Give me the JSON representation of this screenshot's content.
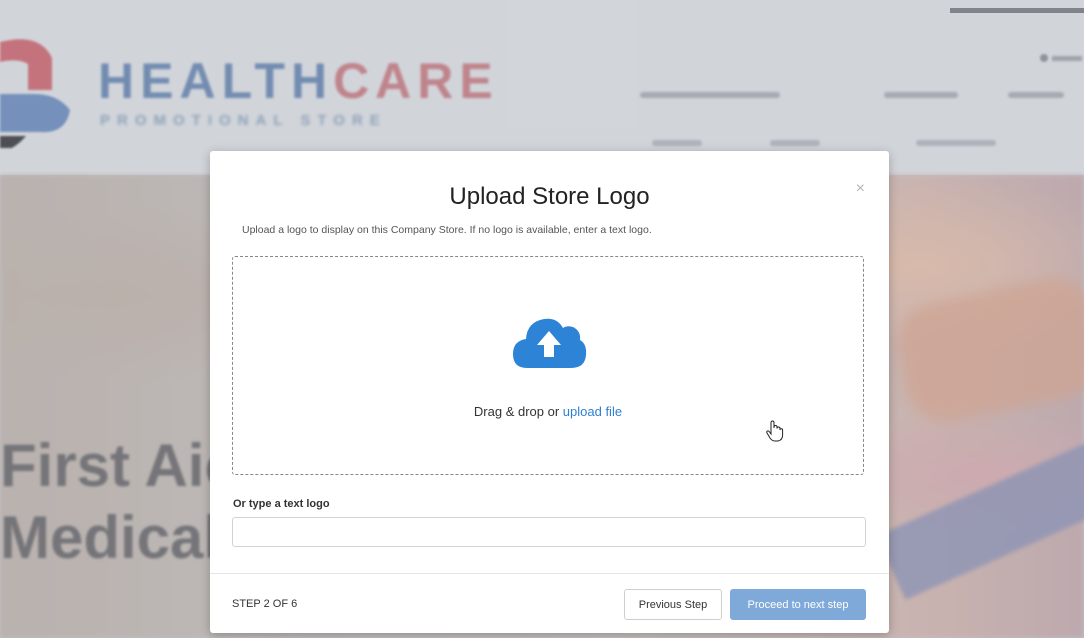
{
  "background": {
    "brand_word_1": "HEALTH",
    "brand_word_2": "CARE",
    "brand_subtitle": "PROMOTIONAL STORE",
    "hero_line_1": "First Aic",
    "hero_line_2": "Medical"
  },
  "modal": {
    "title": "Upload Store Logo",
    "close_label": "×",
    "subtitle": "Upload a logo to display on this Company Store. If no logo is available, enter a text logo.",
    "dropzone": {
      "icon": "cloud-upload-icon",
      "text": "Drag & drop or ",
      "link": "upload file"
    },
    "text_logo": {
      "label": "Or type a text logo",
      "value": "",
      "placeholder": ""
    },
    "footer": {
      "step": "STEP 2 OF 6",
      "prev_button": "Previous Step",
      "next_button": "Proceed to next step"
    }
  },
  "colors": {
    "accent": "#2f7fd2",
    "primary_button": "#7fa9d8",
    "upload_icon": "#2d84d6"
  }
}
